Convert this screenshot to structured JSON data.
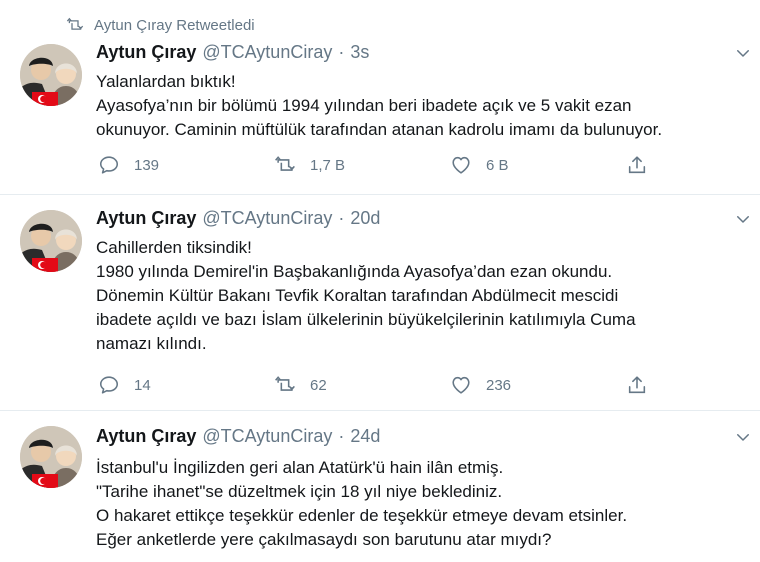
{
  "retweet_label": "Aytun Çıray Retweetledi",
  "tweets": [
    {
      "name": "Aytun Çıray",
      "handle": "@TCAytunCiray",
      "separator": "·",
      "time": "3s",
      "lines": [
        "Yalanlardan bıktık!",
        "Ayasofya’nın bir bölümü 1994 yılından beri ibadete açık ve 5 vakit ezan",
        "okunuyor. Caminin müftülük tarafından atanan kadrolu imamı da bulunuyor."
      ],
      "replies": "139",
      "retweets": "1,7 B",
      "likes": "6 B"
    },
    {
      "name": "Aytun Çıray",
      "handle": "@TCAytunCiray",
      "separator": "·",
      "time": "20d",
      "lines": [
        "Cahillerden tiksindik!",
        "1980 yılında Demirel'in Başbakanlığında Ayasofya’dan ezan okundu.",
        "Dönemin Kültür Bakanı Tevfik Koraltan tarafından Abdülmecit mescidi",
        "ibadete açıldı ve bazı İslam ülkelerinin büyükelçilerinin katılımıyla Cuma",
        "namazı kılındı."
      ],
      "replies": "14",
      "retweets": "62",
      "likes": "236"
    },
    {
      "name": "Aytun Çıray",
      "handle": "@TCAytunCiray",
      "separator": "·",
      "time": "24d",
      "lines": [
        "İstanbul'u İngilizden geri alan Atatürk'ü hain ilân etmiş.",
        "\"Tarihe ihanet\"se düzeltmek için 18 yıl niye beklediniz.",
        "O hakaret ettikçe teşekkür edenler de teşekkür etmeye devam etsinler.",
        "Eğer anketlerde yere çakılmasaydı son barutunu atar mıydı?"
      ]
    }
  ],
  "colors": {
    "text": "#14171a",
    "muted": "#657786",
    "divider": "#e6ecf0",
    "flag_red": "#e30a17"
  },
  "icons": {
    "retweet_context": "retweet-icon",
    "reply": "reply-icon",
    "retweet": "retweet-icon",
    "like": "heart-icon",
    "share": "share-icon",
    "menu": "chevron-down-icon"
  }
}
